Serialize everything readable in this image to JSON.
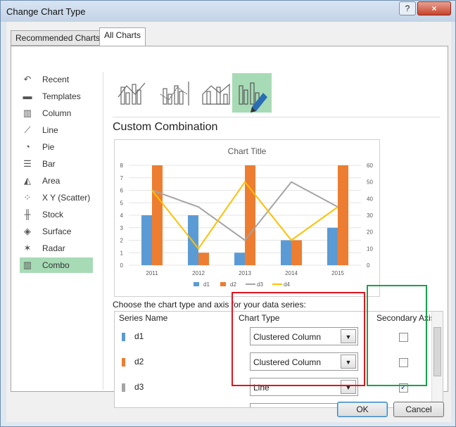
{
  "window": {
    "title": "Change Chart Type",
    "help": "?",
    "close": "×"
  },
  "tabs": [
    "Recommended Charts",
    "All Charts"
  ],
  "nav": [
    {
      "label": "Recent",
      "icon": "recent-icon",
      "glyph": "↶"
    },
    {
      "label": "Templates",
      "icon": "folder-icon",
      "glyph": "▬"
    },
    {
      "label": "Column",
      "icon": "column-chart-icon",
      "glyph": "▥"
    },
    {
      "label": "Line",
      "icon": "line-chart-icon",
      "glyph": "⟋"
    },
    {
      "label": "Pie",
      "icon": "pie-chart-icon",
      "glyph": "◔"
    },
    {
      "label": "Bar",
      "icon": "bar-chart-icon",
      "glyph": "☰"
    },
    {
      "label": "Area",
      "icon": "area-chart-icon",
      "glyph": "◭"
    },
    {
      "label": "X Y (Scatter)",
      "icon": "scatter-chart-icon",
      "glyph": "⁘"
    },
    {
      "label": "Stock",
      "icon": "stock-chart-icon",
      "glyph": "╫"
    },
    {
      "label": "Surface",
      "icon": "surface-chart-icon",
      "glyph": "◈"
    },
    {
      "label": "Radar",
      "icon": "radar-chart-icon",
      "glyph": "✶"
    },
    {
      "label": "Combo",
      "icon": "combo-chart-icon",
      "glyph": "▥"
    }
  ],
  "section_title": "Custom Combination",
  "series_instruction": "Choose the chart type and axis for your data series:",
  "grid_headers": {
    "name": "Series Name",
    "type": "Chart Type",
    "axis": "Secondary Axis"
  },
  "series": [
    {
      "name": "d1",
      "type": "Clustered Column",
      "secondary": false,
      "color": "#5b9bd5"
    },
    {
      "name": "d2",
      "type": "Clustered Column",
      "secondary": false,
      "color": "#ed7d31"
    },
    {
      "name": "d3",
      "type": "Line",
      "secondary": true,
      "color": "#a5a5a5"
    },
    {
      "name": "d4",
      "type": "",
      "secondary": false,
      "color": "#ffc000"
    }
  ],
  "buttons": {
    "ok": "OK",
    "cancel": "Cancel"
  },
  "chart_data": {
    "type": "bar",
    "title": "Chart Title",
    "categories": [
      "2011",
      "2012",
      "2013",
      "2014",
      "2015"
    ],
    "series": [
      {
        "name": "d1",
        "kind": "column",
        "axis": "primary",
        "values": [
          4,
          4,
          1,
          2,
          3
        ],
        "color": "#5b9bd5"
      },
      {
        "name": "d2",
        "kind": "column",
        "axis": "primary",
        "values": [
          8,
          1,
          8,
          2,
          8
        ],
        "color": "#ed7d31"
      },
      {
        "name": "d3",
        "kind": "line",
        "axis": "secondary",
        "values": [
          45,
          35,
          15,
          50,
          35
        ],
        "color": "#a5a5a5"
      },
      {
        "name": "d4",
        "kind": "line",
        "axis": "secondary",
        "values": [
          45,
          10,
          50,
          15,
          35
        ],
        "color": "#ffc000"
      }
    ],
    "ylim": [
      0,
      8
    ],
    "y2lim": [
      0,
      60
    ],
    "yticks": [
      "0",
      "1",
      "2",
      "3",
      "4",
      "5",
      "6",
      "7",
      "8"
    ],
    "y2ticks": [
      "0",
      "10",
      "20",
      "30",
      "40",
      "50",
      "60"
    ],
    "legend": "bottom",
    "grid": true
  }
}
